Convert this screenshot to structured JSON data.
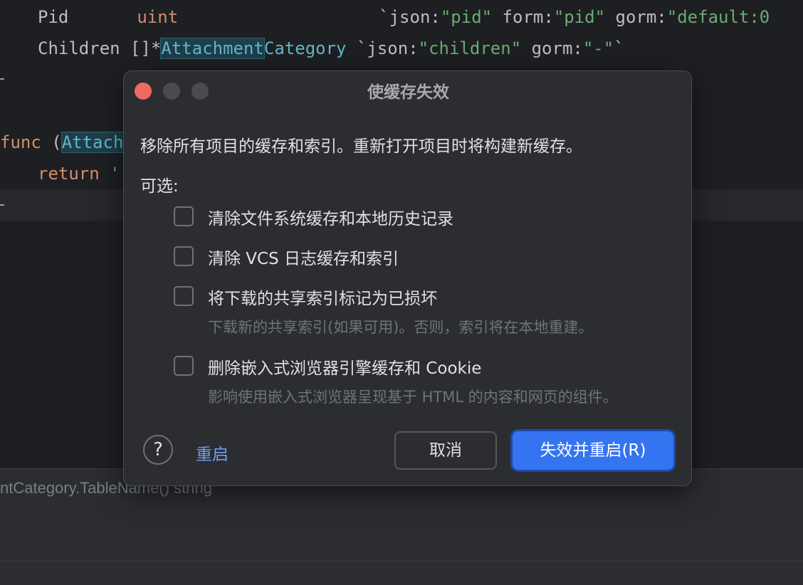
{
  "editor": {
    "line1": {
      "field": "Pid",
      "type": "uint",
      "tag_open": "`json:",
      "json_val": "\"pid\"",
      "form_key": " form:",
      "form_val": "\"pid\"",
      "gorm_key": " gorm:",
      "gorm_val": "\"default:0"
    },
    "line2": {
      "field": "Children",
      "type_prefix": "[]*",
      "type_hl": "Attachment",
      "type_rest": "Category",
      "tag_open": " `json:",
      "json_val": "\"children\"",
      "gorm_key": " gorm:",
      "gorm_val": "\"-\"",
      "tag_close": "`"
    },
    "line3": {
      "kw": "func",
      "paren": " (",
      "receiver_hl": "Attach"
    },
    "line4": {
      "kw": "return",
      "rest": " '"
    },
    "hover_signature": "ntCategory.TableName() string"
  },
  "dialog": {
    "title": "使缓存失效",
    "description": "移除所有项目的缓存和索引。重新打开项目时将构建新缓存。",
    "optional_label": "可选:",
    "options": [
      {
        "label": "清除文件系统缓存和本地历史记录",
        "checked": false
      },
      {
        "label": "清除 VCS 日志缓存和索引",
        "checked": false
      },
      {
        "label": "将下载的共享索引标记为已损坏",
        "hint": "下载新的共享索引(如果可用)。否则，索引将在本地重建。",
        "checked": false
      },
      {
        "label": "删除嵌入式浏览器引擎缓存和 Cookie",
        "hint": "影响使用嵌入式浏览器呈现基于 HTML 的内容和网页的组件。",
        "checked": false
      }
    ],
    "help_glyph": "?",
    "restart_link": "重启",
    "cancel_button": "取消",
    "primary_button": "失效并重启(R)"
  },
  "colors": {
    "accent": "#3574f0",
    "link": "#6e9ff5",
    "close_dot": "#ec6a5e"
  }
}
